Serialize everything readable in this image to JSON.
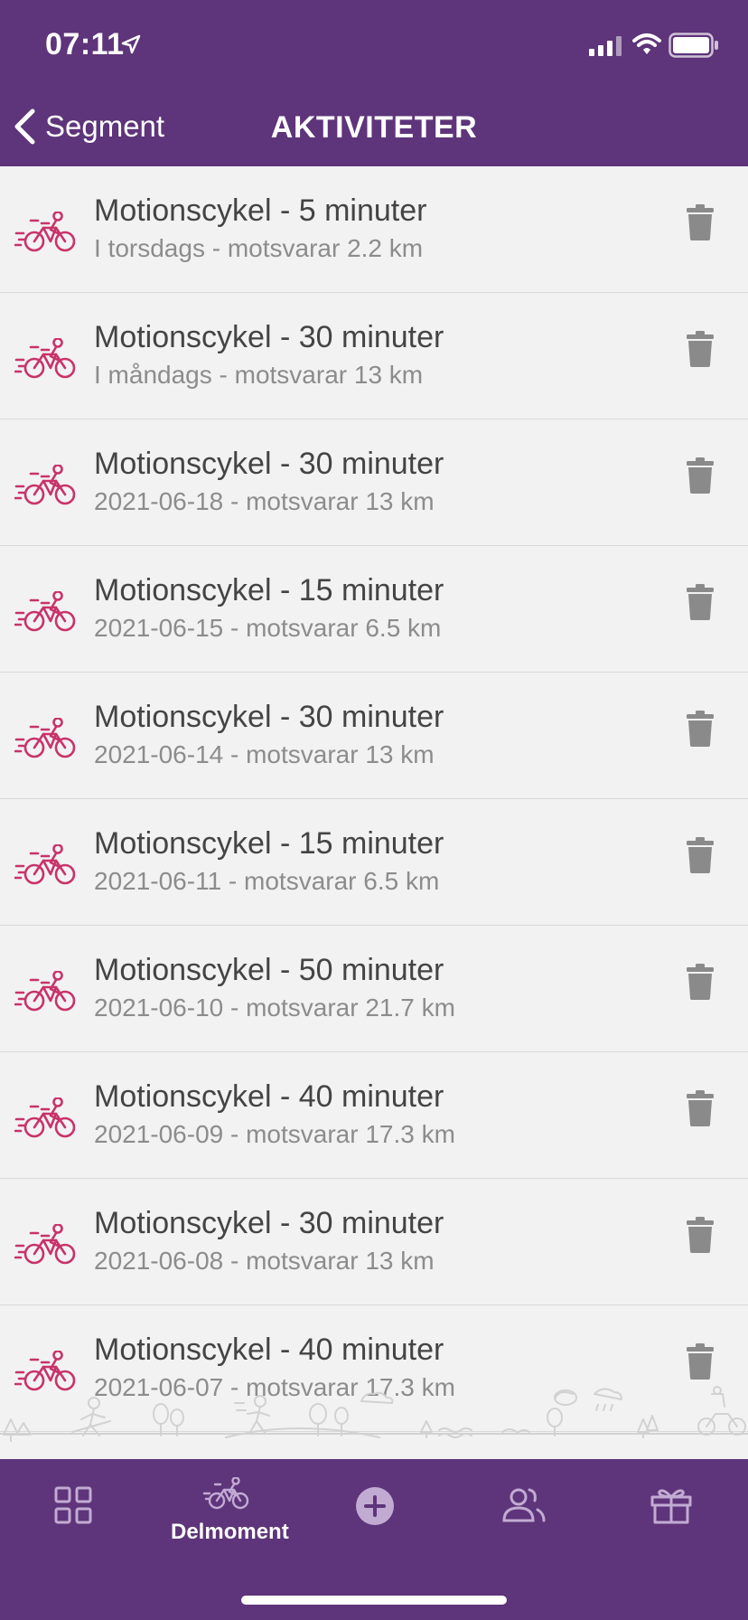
{
  "status": {
    "time": "07:11"
  },
  "nav": {
    "back_label": "Segment",
    "title": "AKTIVITETER"
  },
  "activities": [
    {
      "title": "Motionscykel - 5 minuter",
      "subtitle": "I torsdags - motsvarar 2.2 km"
    },
    {
      "title": "Motionscykel - 30 minuter",
      "subtitle": "I måndags - motsvarar 13 km"
    },
    {
      "title": "Motionscykel - 30 minuter",
      "subtitle": "2021-06-18 - motsvarar 13 km"
    },
    {
      "title": "Motionscykel - 15 minuter",
      "subtitle": "2021-06-15 - motsvarar 6.5 km"
    },
    {
      "title": "Motionscykel - 30 minuter",
      "subtitle": "2021-06-14 - motsvarar 13 km"
    },
    {
      "title": "Motionscykel - 15 minuter",
      "subtitle": "2021-06-11 - motsvarar 6.5 km"
    },
    {
      "title": "Motionscykel - 50 minuter",
      "subtitle": "2021-06-10 - motsvarar 21.7 km"
    },
    {
      "title": "Motionscykel - 40 minuter",
      "subtitle": "2021-06-09 - motsvarar 17.3 km"
    },
    {
      "title": "Motionscykel - 30 minuter",
      "subtitle": "2021-06-08 - motsvarar 13 km"
    },
    {
      "title": "Motionscykel - 40 minuter",
      "subtitle": "2021-06-07 - motsvarar 17.3 km"
    }
  ],
  "tabbar": {
    "active_label": "Delmoment",
    "tabs": [
      "grid-icon",
      "bike-icon",
      "plus-circle-icon",
      "people-icon",
      "gift-icon"
    ]
  },
  "colors": {
    "brand_purple": "#5e347a",
    "bike_pink": "#c8336a",
    "trash_gray": "#8a8a8a",
    "background": "#f2f2f2"
  }
}
